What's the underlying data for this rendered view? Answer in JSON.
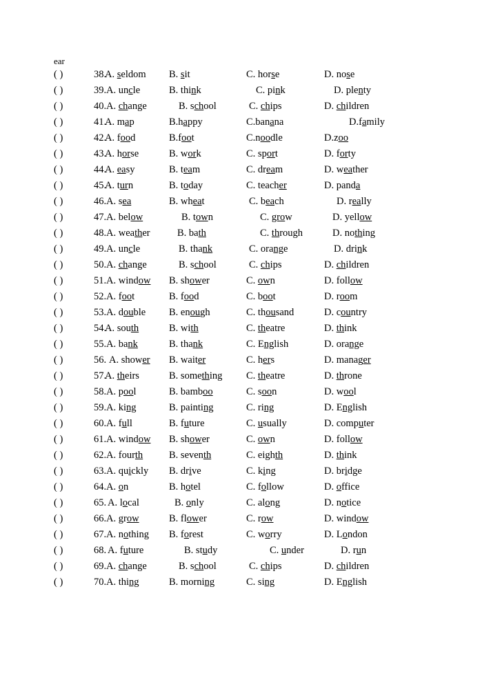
{
  "page": {
    "fragment_text": "ear",
    "bracket": "(          )"
  },
  "questions": [
    {
      "number": "38.",
      "a": {
        "label": "A.",
        "pre": "",
        "mark": "s",
        "post": "eldom"
      },
      "b": {
        "label": "B.",
        "pre": "",
        "mark": "s",
        "post": "it"
      },
      "c": {
        "label": "C.",
        "pre": "hor",
        "mark": "s",
        "post": "e"
      },
      "d": {
        "label": "D.",
        "pre": "no",
        "mark": "s",
        "post": "e"
      },
      "indent": {
        "a": 0,
        "b": 0,
        "c": 0,
        "d": 0
      }
    },
    {
      "number": "39.",
      "a": {
        "label": "A.",
        "pre": "un",
        "mark": "c",
        "post": "le"
      },
      "b": {
        "label": "B.",
        "pre": "thi",
        "mark": "n",
        "post": "k"
      },
      "c": {
        "label": "C.",
        "pre": "pi",
        "mark": "n",
        "post": "k"
      },
      "d": {
        "label": "D.",
        "pre": "ple",
        "mark": "n",
        "post": "ty"
      },
      "indent": {
        "a": 2,
        "b": 0,
        "c": 14,
        "d": 14
      }
    },
    {
      "number": "40.",
      "a": {
        "label": "A.",
        "pre": "",
        "mark": "ch",
        "post": "ange"
      },
      "b": {
        "label": "B.",
        "pre": "s",
        "mark": "ch",
        "post": "ool"
      },
      "c": {
        "label": "C.",
        "pre": "",
        "mark": "ch",
        "post": "ips"
      },
      "d": {
        "label": "D.",
        "pre": "",
        "mark": "ch",
        "post": "ildren"
      },
      "indent": {
        "a": 2,
        "b": 14,
        "c": 4,
        "d": 0
      }
    },
    {
      "number": "41.",
      "a": {
        "label": "A.",
        "pre": "m",
        "mark": "a",
        "post": "p"
      },
      "b": {
        "label": "B.",
        "pre": "h",
        "mark": "a",
        "post": "ppy",
        "tight": true
      },
      "c": {
        "label": "C.",
        "pre": "ban",
        "mark": "a",
        "post": "na",
        "tight": true
      },
      "d": {
        "label": "D.",
        "pre": "f",
        "mark": "a",
        "post": "mily",
        "tight": true
      },
      "indent": {
        "a": 0,
        "b": 0,
        "c": 0,
        "d": 36
      }
    },
    {
      "number": "42.",
      "a": {
        "label": "A.",
        "pre": "f",
        "mark": "oo",
        "post": "d"
      },
      "b": {
        "label": "B.",
        "pre": "f",
        "mark": "oo",
        "post": "t",
        "tight": true
      },
      "c": {
        "label": "C.",
        "pre": "n",
        "mark": "oo",
        "post": "dle",
        "tight": true
      },
      "d": {
        "label": "D.",
        "pre": "z",
        "mark": "oo",
        "post": "",
        "tight": true
      },
      "indent": {
        "a": 0,
        "b": 0,
        "c": 0,
        "d": 0
      }
    },
    {
      "number": "43.",
      "a": {
        "label": "A.",
        "pre": "h",
        "mark": "or",
        "post": "se"
      },
      "b": {
        "label": "B.",
        "pre": "w",
        "mark": "or",
        "post": "k"
      },
      "c": {
        "label": "C.",
        "pre": "sp",
        "mark": "or",
        "post": "t"
      },
      "d": {
        "label": "D.",
        "pre": "f",
        "mark": "or",
        "post": "ty"
      },
      "indent": {
        "a": 0,
        "b": 0,
        "c": 0,
        "d": 0
      }
    },
    {
      "number": "44.",
      "a": {
        "label": "A.",
        "pre": "",
        "mark": "ea",
        "post": "sy"
      },
      "b": {
        "label": "B.",
        "pre": "t",
        "mark": "ea",
        "post": "m"
      },
      "c": {
        "label": "C.",
        "pre": "dr",
        "mark": "ea",
        "post": "m"
      },
      "d": {
        "label": "D.",
        "pre": "w",
        "mark": "ea",
        "post": "ther"
      },
      "indent": {
        "a": 0,
        "b": 0,
        "c": 0,
        "d": 0
      }
    },
    {
      "number": "45.",
      "a": {
        "label": "A.",
        "pre": "t",
        "mark": "ur",
        "post": "n"
      },
      "b": {
        "label": "B.",
        "pre": "t",
        "mark": "o",
        "post": "day"
      },
      "c": {
        "label": "C.",
        "pre": "teach",
        "mark": "er",
        "post": ""
      },
      "d": {
        "label": "D.",
        "pre": "pand",
        "mark": "a",
        "post": ""
      },
      "indent": {
        "a": 0,
        "b": 0,
        "c": 0,
        "d": 0
      }
    },
    {
      "number": "46.",
      "a": {
        "label": "A.",
        "pre": "s",
        "mark": "ea",
        "post": ""
      },
      "b": {
        "label": "B.",
        "pre": "wh",
        "mark": "ea",
        "post": "t"
      },
      "c": {
        "label": "C.",
        "pre": "b",
        "mark": "ea",
        "post": "ch"
      },
      "d": {
        "label": "D.",
        "pre": "r",
        "mark": "ea",
        "post": "lly"
      },
      "indent": {
        "a": 2,
        "b": 0,
        "c": 4,
        "d": 18
      }
    },
    {
      "number": "47.",
      "a": {
        "label": "A.",
        "pre": "bel",
        "mark": "ow",
        "post": ""
      },
      "b": {
        "label": "B.",
        "pre": "t",
        "mark": "ow",
        "post": "n"
      },
      "c": {
        "label": "C.",
        "pre": "",
        "mark": "gro",
        "post": "w"
      },
      "d": {
        "label": "D.",
        "pre": "yell",
        "mark": "ow",
        "post": ""
      },
      "indent": {
        "a": 2,
        "b": 18,
        "c": 20,
        "d": 12
      }
    },
    {
      "number": "48.",
      "a": {
        "label": "A.",
        "pre": "wea",
        "mark": "th",
        "post": "er"
      },
      "b": {
        "label": "B.",
        "pre": "ba",
        "mark": "th",
        "post": ""
      },
      "c": {
        "label": "C.",
        "pre": "",
        "mark": "th",
        "post": "rough"
      },
      "d": {
        "label": "D.",
        "pre": "no",
        "mark": "th",
        "post": "ing"
      },
      "indent": {
        "a": 2,
        "b": 12,
        "c": 20,
        "d": 12
      }
    },
    {
      "number": "49.",
      "a": {
        "label": "A.",
        "pre": "un",
        "mark": "c",
        "post": "le"
      },
      "b": {
        "label": "B.",
        "pre": "tha",
        "mark": "nk",
        "post": ""
      },
      "c": {
        "label": "C.",
        "pre": "ora",
        "mark": "ng",
        "post": "e"
      },
      "d": {
        "label": "D.",
        "pre": "dri",
        "mark": "n",
        "post": "k"
      },
      "indent": {
        "a": 2,
        "b": 14,
        "c": 4,
        "d": 14
      }
    },
    {
      "number": "50.",
      "a": {
        "label": "A.",
        "pre": "",
        "mark": "ch",
        "post": "ange"
      },
      "b": {
        "label": "B.",
        "pre": "s",
        "mark": "ch",
        "post": "ool"
      },
      "c": {
        "label": "C.",
        "pre": "",
        "mark": "ch",
        "post": "ips"
      },
      "d": {
        "label": "D.",
        "pre": "",
        "mark": "ch",
        "post": "ildren"
      },
      "indent": {
        "a": 2,
        "b": 14,
        "c": 4,
        "d": 0
      }
    },
    {
      "number": "51.",
      "a": {
        "label": "A.",
        "pre": "wind",
        "mark": "ow",
        "post": ""
      },
      "b": {
        "label": "B.",
        "pre": "sh",
        "mark": "ow",
        "post": "er"
      },
      "c": {
        "label": "C.",
        "pre": "",
        "mark": "ow",
        "post": "n"
      },
      "d": {
        "label": "D.",
        "pre": "foll",
        "mark": "ow",
        "post": ""
      },
      "indent": {
        "a": 2,
        "b": 0,
        "c": 0,
        "d": 0
      }
    },
    {
      "number": "52.",
      "a": {
        "label": "A.",
        "pre": "f",
        "mark": "oo",
        "post": "t"
      },
      "b": {
        "label": "B.",
        "pre": "f",
        "mark": "oo",
        "post": "d"
      },
      "c": {
        "label": "C.",
        "pre": "b",
        "mark": "oo",
        "post": "t"
      },
      "d": {
        "label": "D.",
        "pre": "r",
        "mark": "oo",
        "post": "m"
      },
      "indent": {
        "a": 2,
        "b": 0,
        "c": 0,
        "d": 0
      }
    },
    {
      "number": "53.",
      "a": {
        "label": "A.",
        "pre": "d",
        "mark": "ou",
        "post": "ble"
      },
      "b": {
        "label": "B.",
        "pre": "en",
        "mark": "ou",
        "post": "gh"
      },
      "c": {
        "label": "C.",
        "pre": "th",
        "mark": "ou",
        "post": "sand"
      },
      "d": {
        "label": "D.",
        "pre": "c",
        "mark": "ou",
        "post": "ntry"
      },
      "indent": {
        "a": 2,
        "b": 0,
        "c": 0,
        "d": 0
      }
    },
    {
      "number": "54.",
      "a": {
        "label": "A.",
        "pre": "sou",
        "mark": "th",
        "post": ""
      },
      "b": {
        "label": "B.",
        "pre": "wi",
        "mark": "th",
        "post": ""
      },
      "c": {
        "label": "C.",
        "pre": "",
        "mark": "th",
        "post": "eatre"
      },
      "d": {
        "label": "D.",
        "pre": "",
        "mark": "th",
        "post": "ink"
      },
      "indent": {
        "a": 0,
        "b": 0,
        "c": 0,
        "d": 0
      }
    },
    {
      "number": "55.",
      "a": {
        "label": "A.",
        "pre": "ba",
        "mark": "nk",
        "post": ""
      },
      "b": {
        "label": "B.",
        "pre": "tha",
        "mark": "nk",
        "post": ""
      },
      "c": {
        "label": "C.",
        "pre": "E",
        "mark": "ng",
        "post": "lish"
      },
      "d": {
        "label": "D.",
        "pre": "ora",
        "mark": "ng",
        "post": "e"
      },
      "indent": {
        "a": 2,
        "b": 0,
        "c": 0,
        "d": 0
      }
    },
    {
      "number": "56.",
      "a": {
        "label": "A.",
        "pre": "show",
        "mark": "er",
        "post": ""
      },
      "b": {
        "label": "B.",
        "pre": "wait",
        "mark": "er",
        "post": ""
      },
      "c": {
        "label": "C.",
        "pre": "h",
        "mark": "er",
        "post": "s"
      },
      "d": {
        "label": "D.",
        "pre": "manag",
        "mark": "er",
        "post": ""
      },
      "indent": {
        "a": 6,
        "b": 0,
        "c": 0,
        "d": 0
      }
    },
    {
      "number": "57.",
      "a": {
        "label": "A.",
        "pre": "",
        "mark": "th",
        "post": "eirs"
      },
      "b": {
        "label": "B.",
        "pre": "some",
        "mark": "th",
        "post": "ing"
      },
      "c": {
        "label": "C.",
        "pre": "",
        "mark": "th",
        "post": "eatre"
      },
      "d": {
        "label": "D.",
        "pre": "",
        "mark": "th",
        "post": "rone"
      },
      "indent": {
        "a": 0,
        "b": 0,
        "c": 0,
        "d": 0
      }
    },
    {
      "number": "58.",
      "a": {
        "label": "A.",
        "pre": "p",
        "mark": "oo",
        "post": "l"
      },
      "b": {
        "label": "B.",
        "pre": "bamb",
        "mark": "oo",
        "post": ""
      },
      "c": {
        "label": "C.",
        "pre": "s",
        "mark": "oo",
        "post": "n"
      },
      "d": {
        "label": "D.",
        "pre": "w",
        "mark": "oo",
        "post": "l"
      },
      "indent": {
        "a": 2,
        "b": 0,
        "c": 0,
        "d": 0
      }
    },
    {
      "number": "59.",
      "a": {
        "label": "A.",
        "pre": "ki",
        "mark": "ng",
        "post": ""
      },
      "b": {
        "label": "B.",
        "pre": "painti",
        "mark": "ng",
        "post": ""
      },
      "c": {
        "label": "C.",
        "pre": "ri",
        "mark": "ng",
        "post": ""
      },
      "d": {
        "label": "D.",
        "pre": "E",
        "mark": "ng",
        "post": "lish"
      },
      "indent": {
        "a": 2,
        "b": 0,
        "c": 0,
        "d": 0
      }
    },
    {
      "number": "60.",
      "a": {
        "label": "A.",
        "pre": "f",
        "mark": "u",
        "post": "ll"
      },
      "b": {
        "label": "B.",
        "pre": "f",
        "mark": "u",
        "post": "ture"
      },
      "c": {
        "label": "C.",
        "pre": "",
        "mark": "u",
        "post": "sually"
      },
      "d": {
        "label": "D.",
        "pre": "comp",
        "mark": "u",
        "post": "ter"
      },
      "indent": {
        "a": 2,
        "b": 0,
        "c": 0,
        "d": 0
      }
    },
    {
      "number": "61.",
      "a": {
        "label": "A.",
        "pre": "wind",
        "mark": "ow",
        "post": ""
      },
      "b": {
        "label": "B.",
        "pre": "sh",
        "mark": "ow",
        "post": "er"
      },
      "c": {
        "label": "C.",
        "pre": "",
        "mark": "ow",
        "post": "n"
      },
      "d": {
        "label": "D.",
        "pre": "foll",
        "mark": "ow",
        "post": ""
      },
      "indent": {
        "a": 2,
        "b": 0,
        "c": 0,
        "d": 0
      }
    },
    {
      "number": "62.",
      "a": {
        "label": "A.",
        "pre": "four",
        "mark": "th",
        "post": ""
      },
      "b": {
        "label": "B.",
        "pre": "seven",
        "mark": "th",
        "post": ""
      },
      "c": {
        "label": "C.",
        "pre": "eigh",
        "mark": "th",
        "post": ""
      },
      "d": {
        "label": "D.",
        "pre": "",
        "mark": "th",
        "post": "ink"
      },
      "indent": {
        "a": 2,
        "b": 0,
        "c": 0,
        "d": 0
      }
    },
    {
      "number": "63.",
      "a": {
        "label": "A.",
        "pre": "qu",
        "mark": "i",
        "post": "ckly"
      },
      "b": {
        "label": "B.",
        "pre": "dr",
        "mark": "i",
        "post": "ve"
      },
      "c": {
        "label": "C.",
        "pre": "k",
        "mark": "i",
        "post": "ng"
      },
      "d": {
        "label": "D.",
        "pre": "br",
        "mark": "i",
        "post": "dge"
      },
      "indent": {
        "a": 2,
        "b": 0,
        "c": 0,
        "d": 0
      }
    },
    {
      "number": "64.",
      "a": {
        "label": "A.",
        "pre": "",
        "mark": "o",
        "post": "n"
      },
      "b": {
        "label": "B.",
        "pre": "h",
        "mark": "o",
        "post": "tel"
      },
      "c": {
        "label": "C.",
        "pre": "f",
        "mark": "o",
        "post": "llow"
      },
      "d": {
        "label": "D.",
        "pre": "",
        "mark": "o",
        "post": "ffice"
      },
      "indent": {
        "a": 2,
        "b": 0,
        "c": 0,
        "d": 0
      }
    },
    {
      "number": "65.",
      "a": {
        "label": "A.",
        "pre": "l",
        "mark": "o",
        "post": "cal"
      },
      "b": {
        "label": "B.",
        "pre": "",
        "mark": "o",
        "post": "nly"
      },
      "c": {
        "label": "C.",
        "pre": "al",
        "mark": "o",
        "post": "ng"
      },
      "d": {
        "label": "D.",
        "pre": "n",
        "mark": "o",
        "post": "tice"
      },
      "indent": {
        "a": 4,
        "b": 8,
        "c": 0,
        "d": 0
      }
    },
    {
      "number": "66.",
      "a": {
        "label": "A.",
        "pre": "gr",
        "mark": "ow",
        "post": ""
      },
      "b": {
        "label": "B.",
        "pre": "fl",
        "mark": "ow",
        "post": "er"
      },
      "c": {
        "label": "C.",
        "pre": "r",
        "mark": "ow",
        "post": ""
      },
      "d": {
        "label": "D.",
        "pre": "wind",
        "mark": "ow",
        "post": ""
      },
      "indent": {
        "a": 2,
        "b": 0,
        "c": 0,
        "d": 0
      }
    },
    {
      "number": "67.",
      "a": {
        "label": "A.",
        "pre": "n",
        "mark": "o",
        "post": "thing"
      },
      "b": {
        "label": "B.",
        "pre": "f",
        "mark": "o",
        "post": "rest"
      },
      "c": {
        "label": "C.",
        "pre": "w",
        "mark": "o",
        "post": "rry"
      },
      "d": {
        "label": "D.",
        "pre": "L",
        "mark": "o",
        "post": "ndon"
      },
      "indent": {
        "a": 2,
        "b": 0,
        "c": 0,
        "d": 0
      }
    },
    {
      "number": "68.",
      "a": {
        "label": "A.",
        "pre": "f",
        "mark": "u",
        "post": "ture"
      },
      "b": {
        "label": "B.",
        "pre": "st",
        "mark": "u",
        "post": "dy"
      },
      "c": {
        "label": "C.",
        "pre": "",
        "mark": "u",
        "post": "nder"
      },
      "d": {
        "label": "D.",
        "pre": "r",
        "mark": "u",
        "post": "n"
      },
      "indent": {
        "a": 4,
        "b": 22,
        "c": 34,
        "d": 24
      }
    },
    {
      "number": "69.",
      "a": {
        "label": "A.",
        "pre": "",
        "mark": "ch",
        "post": "ange"
      },
      "b": {
        "label": "B.",
        "pre": "s",
        "mark": "ch",
        "post": "ool"
      },
      "c": {
        "label": "C.",
        "pre": "",
        "mark": "ch",
        "post": "ips"
      },
      "d": {
        "label": "D.",
        "pre": "",
        "mark": "ch",
        "post": "ildren"
      },
      "indent": {
        "a": 2,
        "b": 14,
        "c": 4,
        "d": 0
      }
    },
    {
      "number": "70.",
      "a": {
        "label": "A.",
        "pre": "thi",
        "mark": "ng",
        "post": ""
      },
      "b": {
        "label": "B.",
        "pre": "morni",
        "mark": "ng",
        "post": ""
      },
      "c": {
        "label": "C.",
        "pre": "si",
        "mark": "ng",
        "post": ""
      },
      "d": {
        "label": "D.",
        "pre": "E",
        "mark": "ng",
        "post": "lish"
      },
      "indent": {
        "a": 2,
        "b": 0,
        "c": 0,
        "d": 0
      }
    }
  ]
}
